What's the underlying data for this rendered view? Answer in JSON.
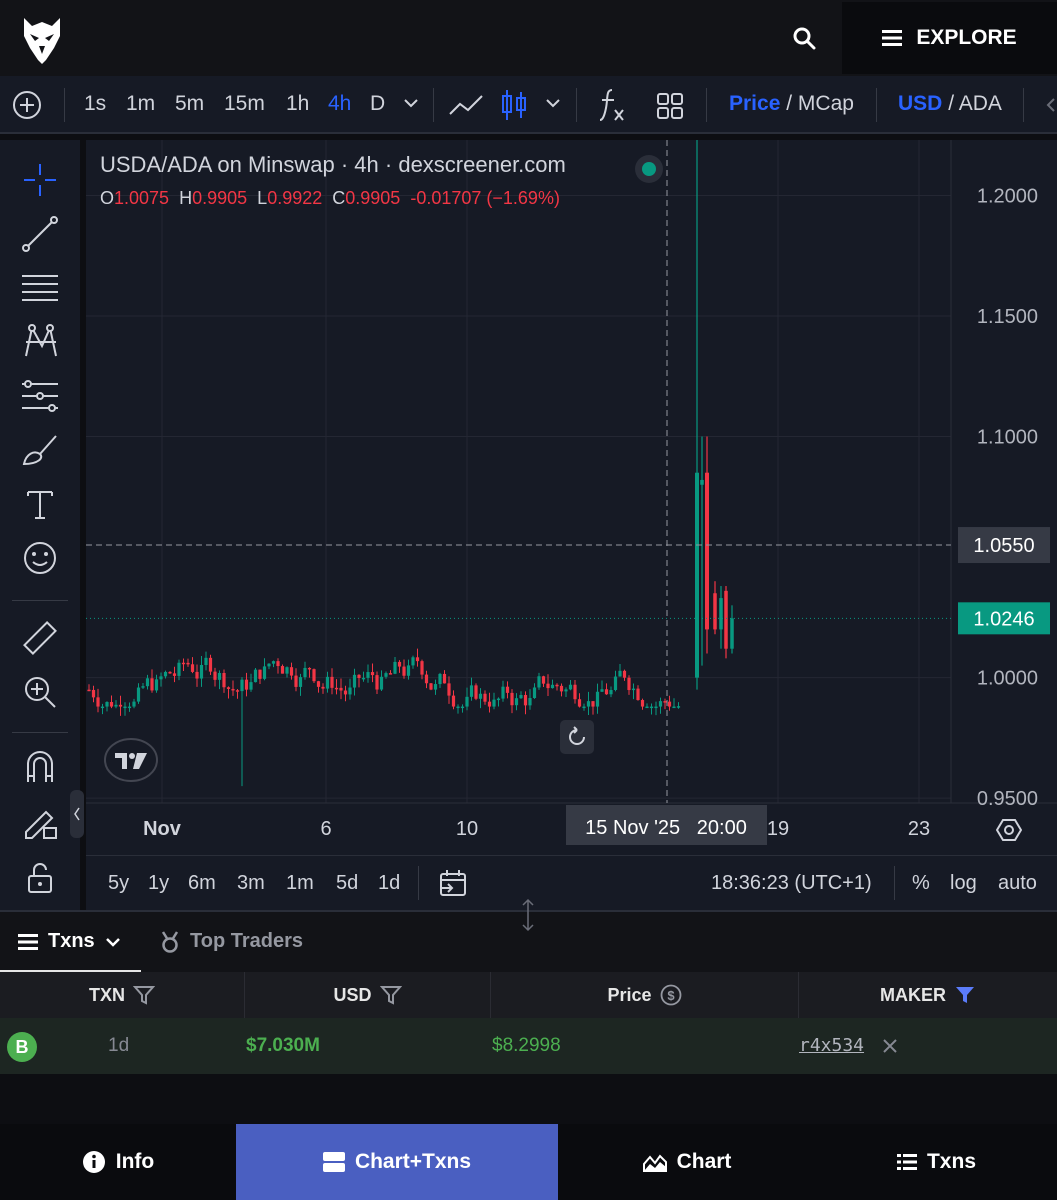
{
  "header": {
    "explore_label": "EXPLORE"
  },
  "toolbar": {
    "intervals": [
      "1s",
      "1m",
      "5m",
      "15m",
      "1h",
      "4h",
      "D"
    ],
    "active_interval": "4h",
    "price_label": "Price",
    "mcap_label": "MCap",
    "usd_label": "USD",
    "ada_label": "ADA",
    "slash": "/"
  },
  "chart": {
    "title": "USDA/ADA on Minswap · 4h · dexscreener.com",
    "ohlc": {
      "o_label": "O",
      "o": "1.0075",
      "h_label": "H",
      "h": "0.9905",
      "l_label": "L",
      "l": "0.9922",
      "c_label": "C",
      "c": "0.9905",
      "change": "-0.01707 (−1.69%)"
    },
    "crosshair_price": "1.0550",
    "last_price": "1.0246",
    "crosshair_time": "15 Nov '25   20:00",
    "colors": {
      "up": "#089981",
      "down": "#f23645",
      "background": "#161a25",
      "accent": "#2962ff"
    }
  },
  "chart_data": {
    "type": "candlestick",
    "pair": "USDA/ADA",
    "interval": "4h",
    "x_tick_labels": [
      "Nov",
      "6",
      "10",
      "19",
      "23"
    ],
    "y_tick_labels": [
      "1.2000",
      "1.1500",
      "1.1000",
      "1.0000",
      "0.9500"
    ],
    "ylim": [
      0.948,
      1.223
    ],
    "last_price": 1.0246,
    "crosshair_price": 1.055,
    "notable_candles": [
      {
        "label": "spike-up",
        "open": 1.0,
        "high": 1.223,
        "low": 0.995,
        "close": 1.085
      },
      {
        "label": "drop",
        "open": 1.085,
        "high": 1.1,
        "low": 1.01,
        "close": 1.02
      }
    ]
  },
  "range": {
    "buttons": [
      "5y",
      "1y",
      "6m",
      "3m",
      "1m",
      "5d",
      "1d"
    ],
    "time": "18:36:23 (UTC+1)",
    "percent": "%",
    "log": "log",
    "auto": "auto"
  },
  "tabs": {
    "txns": "Txns",
    "top_traders": "Top Traders"
  },
  "table": {
    "headers": {
      "txn": "TXN",
      "usd": "USD",
      "price": "Price",
      "maker": "MAKER"
    },
    "rows": [
      {
        "badge": "B",
        "age": "1d",
        "usd": "$7.030M",
        "price": "$8.2998",
        "maker": "r4x534"
      }
    ]
  },
  "bottom_nav": {
    "info": "Info",
    "chart_txns": "Chart+Txns",
    "chart": "Chart",
    "txns": "Txns"
  }
}
